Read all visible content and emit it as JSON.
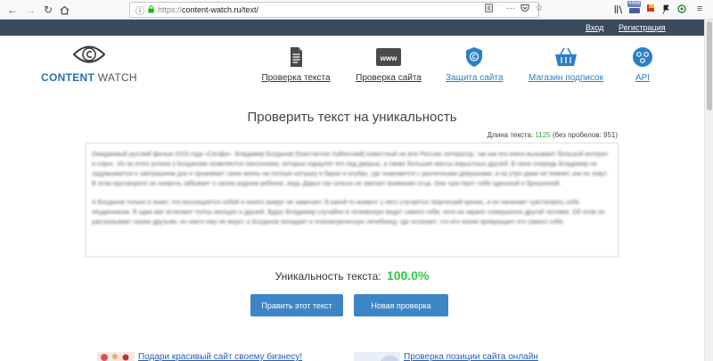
{
  "browser": {
    "url_protocol": "https://",
    "url_rest": "content-watch.ru/text/",
    "badge_count": "4468"
  },
  "topbar": {
    "login": "Вход",
    "register": "Регистрация"
  },
  "logo": {
    "part1": "CONTENT",
    "part2": " WATCH"
  },
  "menu": [
    {
      "label": "Проверка текста",
      "icon": "document-icon"
    },
    {
      "label": "Проверка сайта",
      "icon": "www-icon"
    },
    {
      "label": "Защита сайта",
      "icon": "shield-icon"
    },
    {
      "label": "Магазин подписок",
      "icon": "basket-icon"
    },
    {
      "label": "API",
      "icon": "api-icon"
    }
  ],
  "main": {
    "title": "Проверить текст на уникальность",
    "length_label": "Длина текста:",
    "length_value": "1125",
    "no_spaces": "(без пробелов: 951)",
    "paragraph1": "Ожидаемый русский фильм 2018 года «Селфи». Владимир Богданов (Константин Хабенский) известный на всю Россию литератор, так как его книги вызывают большой интерес и спрос. Из-за этого успеха у Богданова появляются поклонники, которые караулят его под дверью, а также большие массы корыстных друзей. В свою очередь Владимир не задумывается о завтрашнем дне и проживает свою жизнь на полную катушку в барах и клубах, где знакомится с различными девушками, а на утро даже не помнит, как их зовут. В этом круговороте он напрочь забывает о своем родном ребенке, ведь Дарья так сильно не хватает внимания отца. Она чувствует себя одинокой и брошенной.",
    "paragraph2": "А Богданов только и знает, что восхищается собой и никого вокруг не замечает. В какой-то момент у него случается творческий кризис, и он начинает чувствовать себя неудачником. В один миг исчезают толпы женщин и друзей. Вдруг Владимир случайно в телевизоре видит самого себя, хотя на экране совершенно другой человек. Об этом он рассказывает своим друзьям, но никто ему не верит, и Богданов попадает в психиатрическую лечебницу, где осознает, что его копия превращает его самого себя.",
    "uniqueness_label": "Уникальность текста:",
    "uniqueness_value": "100.0%",
    "edit_button": "Править этот текст",
    "new_check_button": "Новая проверка"
  },
  "banners": {
    "left": "Подари красивый сайт своему бизнесу!",
    "right": "Проверка позиции сайта онлайн"
  },
  "colors": {
    "accent": "#3c86c8",
    "topbar": "#3b4a5c",
    "success": "#2ecc40"
  }
}
